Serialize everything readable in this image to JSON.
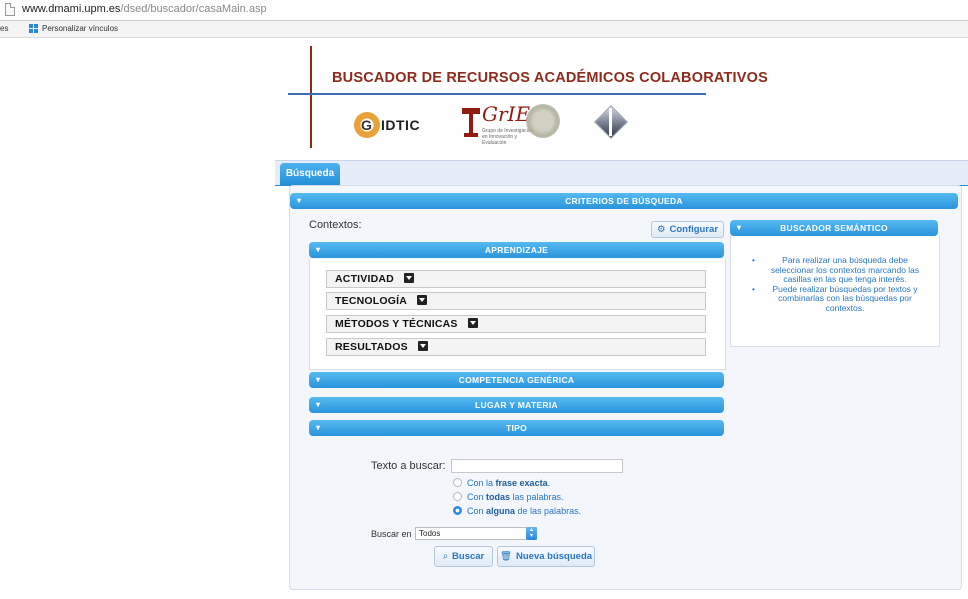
{
  "browser": {
    "url_host": "www.dmami.upm.es",
    "url_path": "/dsed/buscador/casaMain.asp",
    "bookmarks_cut": "es",
    "bookmark_label": "Personalizar vínculos"
  },
  "header": {
    "title": "BUSCADOR DE RECURSOS ACADÉMICOS COLABORATIVOS",
    "logo_gidtic_g": "G",
    "logo_gidtic_text": "IDTIC",
    "logo_grie_text": "GrIE",
    "logo_grie_sub": "Grupo de Investigación en Innovación y Evaluación"
  },
  "tabs": [
    {
      "label": "Búsqueda",
      "active": true
    }
  ],
  "criteria": {
    "header": "CRITERIOS DE BÚSQUEDA",
    "contextos_label": "Contextos:",
    "configurar_label": "Configurar",
    "aprendizaje_header": "APRENDIZAJE",
    "aprendizaje_items": [
      "ACTIVIDAD",
      "TECNOLOGÍA",
      "MÉTODOS Y TÉCNICAS",
      "RESULTADOS"
    ],
    "collapsed_sections": [
      "COMPETENCIA GENÉRICA",
      "LUGAR Y MATERIA",
      "TIPO"
    ]
  },
  "semantic": {
    "header": "BUSCADOR SEMÁNTICO",
    "tips": [
      "Para realizar una búsqueda debe seleccionar los contextos marcando las casillas en las que tenga interés.",
      "Puede realizar búsquedas por textos y combinarlas con las búsquedas por contextos."
    ]
  },
  "search": {
    "text_label": "Texto a buscar:",
    "text_value": "",
    "options": [
      {
        "pre": "Con la ",
        "bold": "frase exacta",
        "post": ".",
        "selected": false
      },
      {
        "pre": "Con ",
        "bold": "todas",
        "post": " las palabras.",
        "selected": false
      },
      {
        "pre": "Con ",
        "bold": "alguna",
        "post": " de las palabras.",
        "selected": true
      }
    ],
    "buscar_en_label": "Buscar en",
    "buscar_en_value": "Todos",
    "buscar_button": "Buscar",
    "nueva_button": "Nueva búsqueda"
  },
  "colors": {
    "accent_blue": "#2a94dc",
    "title_red": "#8e2b1c",
    "link_blue": "#2a77c2"
  }
}
